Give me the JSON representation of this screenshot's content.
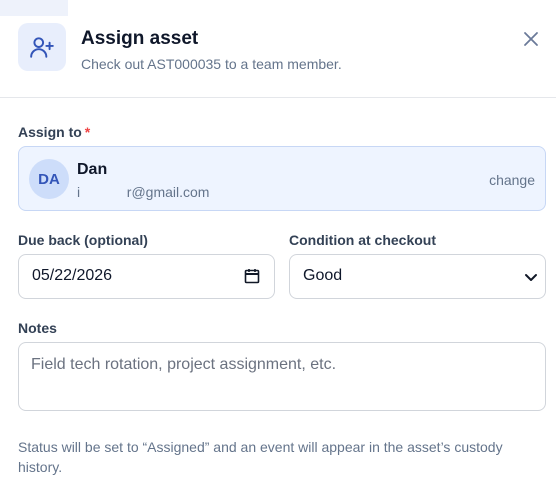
{
  "header": {
    "title": "Assign asset",
    "subtitle": "Check out AST000035 to a team member.",
    "icon": "user-plus-icon",
    "close_icon": "close-icon"
  },
  "assign": {
    "label": "Assign to",
    "required_mark": "*",
    "assignee": {
      "initials": "DA",
      "name": "Dan",
      "email": "i            r@gmail.com"
    },
    "change_label": "change"
  },
  "due": {
    "label": "Due back (optional)",
    "value": "05/22/2026",
    "icon": "calendar-icon"
  },
  "condition": {
    "label": "Condition at checkout",
    "selected": "Good",
    "icon": "chevron-down-icon"
  },
  "notes": {
    "label": "Notes",
    "placeholder": "Field tech rotation, project assignment, etc."
  },
  "footnote": "Status will be set to “Assigned” and an event will appear in the asset’s custody history.",
  "colors": {
    "accent": "#3355b8",
    "required": "#ef4444",
    "assignee_bg": "#eef4ff"
  }
}
